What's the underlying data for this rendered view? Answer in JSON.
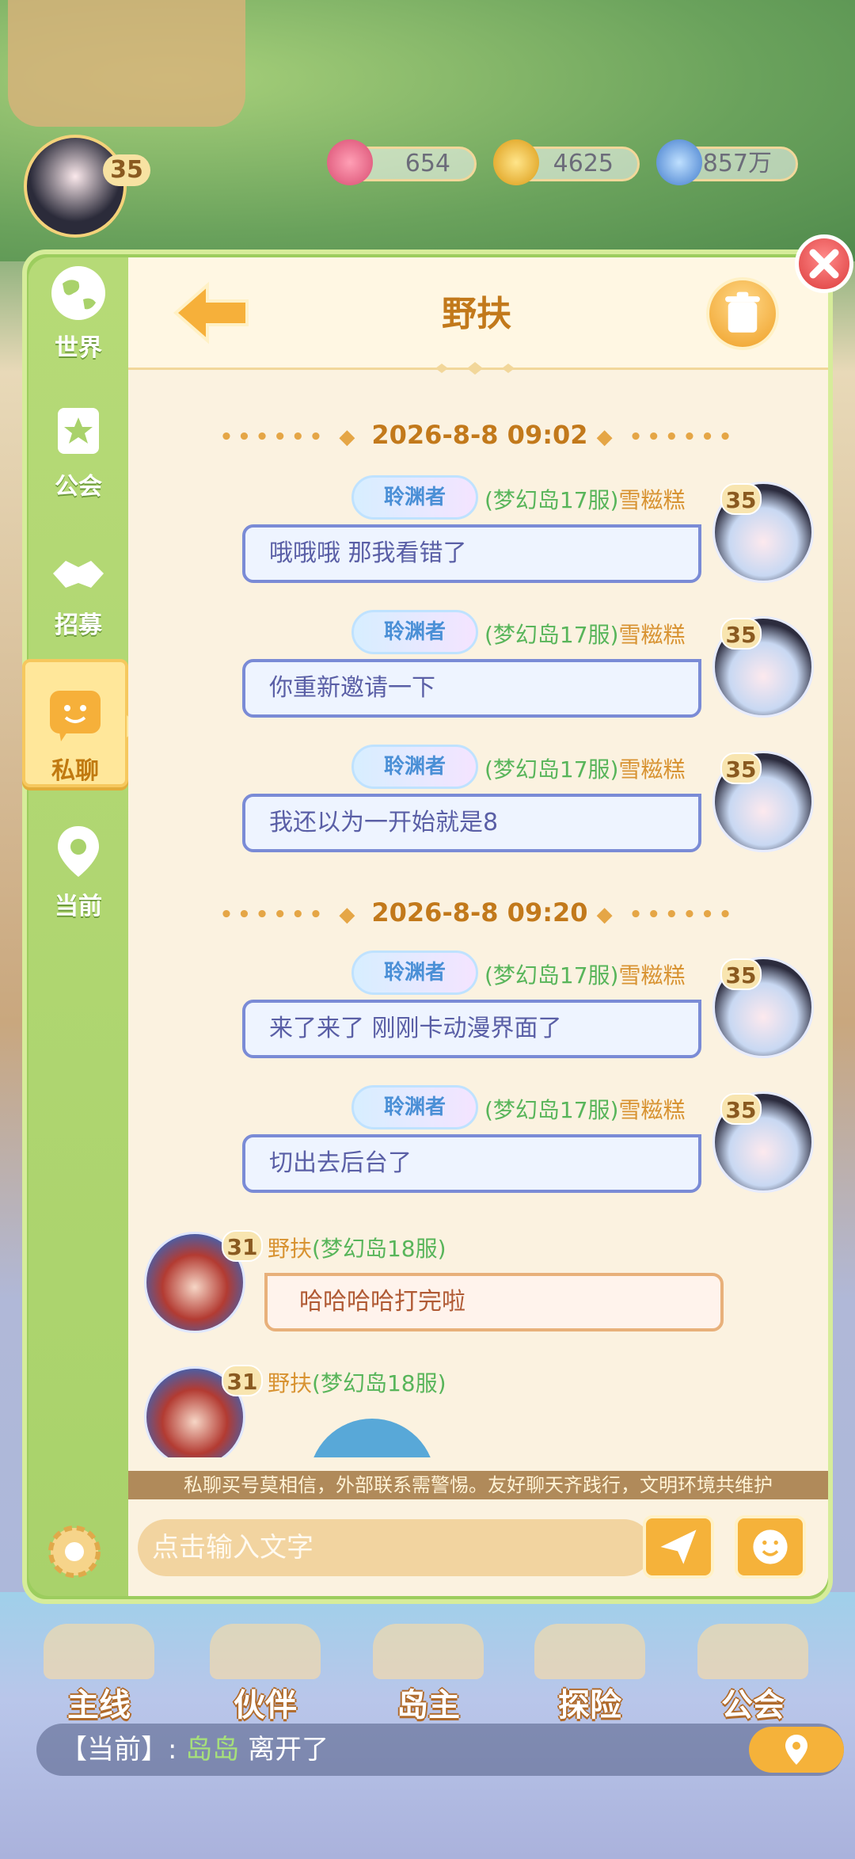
{
  "top": {
    "level": "35",
    "gems": "654",
    "gold": "4625",
    "power": "1857万"
  },
  "sidebar": {
    "items": [
      {
        "label": "世界"
      },
      {
        "label": "公会"
      },
      {
        "label": "招募"
      },
      {
        "label": "私聊"
      },
      {
        "label": "当前"
      }
    ]
  },
  "chat_header": {
    "title": "野扶"
  },
  "messages_block1": {
    "timestamp": "2026-8-8 09:02",
    "m1": {
      "badge": "聆渊者",
      "server": "(梦幻岛17服)",
      "name": "雪糍糕",
      "level": "35",
      "text": "哦哦哦 那我看错了"
    },
    "m2": {
      "badge": "聆渊者",
      "server": "(梦幻岛17服)",
      "name": "雪糍糕",
      "level": "35",
      "text": "你重新邀请一下"
    },
    "m3": {
      "badge": "聆渊者",
      "server": "(梦幻岛17服)",
      "name": "雪糍糕",
      "level": "35",
      "text": "我还以为一开始就是8"
    }
  },
  "messages_block2": {
    "timestamp": "2026-8-8 09:20",
    "m1": {
      "badge": "聆渊者",
      "server": "(梦幻岛17服)",
      "name": "雪糍糕",
      "level": "35",
      "text": "来了来了 刚刚卡动漫界面了"
    },
    "m2": {
      "badge": "聆渊者",
      "server": "(梦幻岛17服)",
      "name": "雪糍糕",
      "level": "35",
      "text": "切出去后台了"
    },
    "m3": {
      "name": "野扶",
      "server": "(梦幻岛18服)",
      "level": "31",
      "text": "哈哈哈哈打完啦"
    },
    "m4": {
      "name": "野扶",
      "server": "(梦幻岛18服)",
      "level": "31"
    }
  },
  "notice": "私聊买号莫相信，外部联系需警惕。友好聊天齐践行，文明环境共维护",
  "input": {
    "placeholder": "点击输入文字"
  },
  "bottom_nav": {
    "items": [
      {
        "label": "主线"
      },
      {
        "label": "伙伴"
      },
      {
        "label": "岛主"
      },
      {
        "label": "探险"
      },
      {
        "label": "公会"
      }
    ]
  },
  "status": {
    "prefix": "【当前】:",
    "name": "岛岛",
    "action": "离开了"
  },
  "colors": {
    "accent_orange": "#f5b23a",
    "title_brown": "#c2791b",
    "server_green": "#58b55a",
    "name_gold": "#d89332",
    "bubble_me_border": "#7a8bd6",
    "bubble_other_border": "#e8b07a"
  }
}
